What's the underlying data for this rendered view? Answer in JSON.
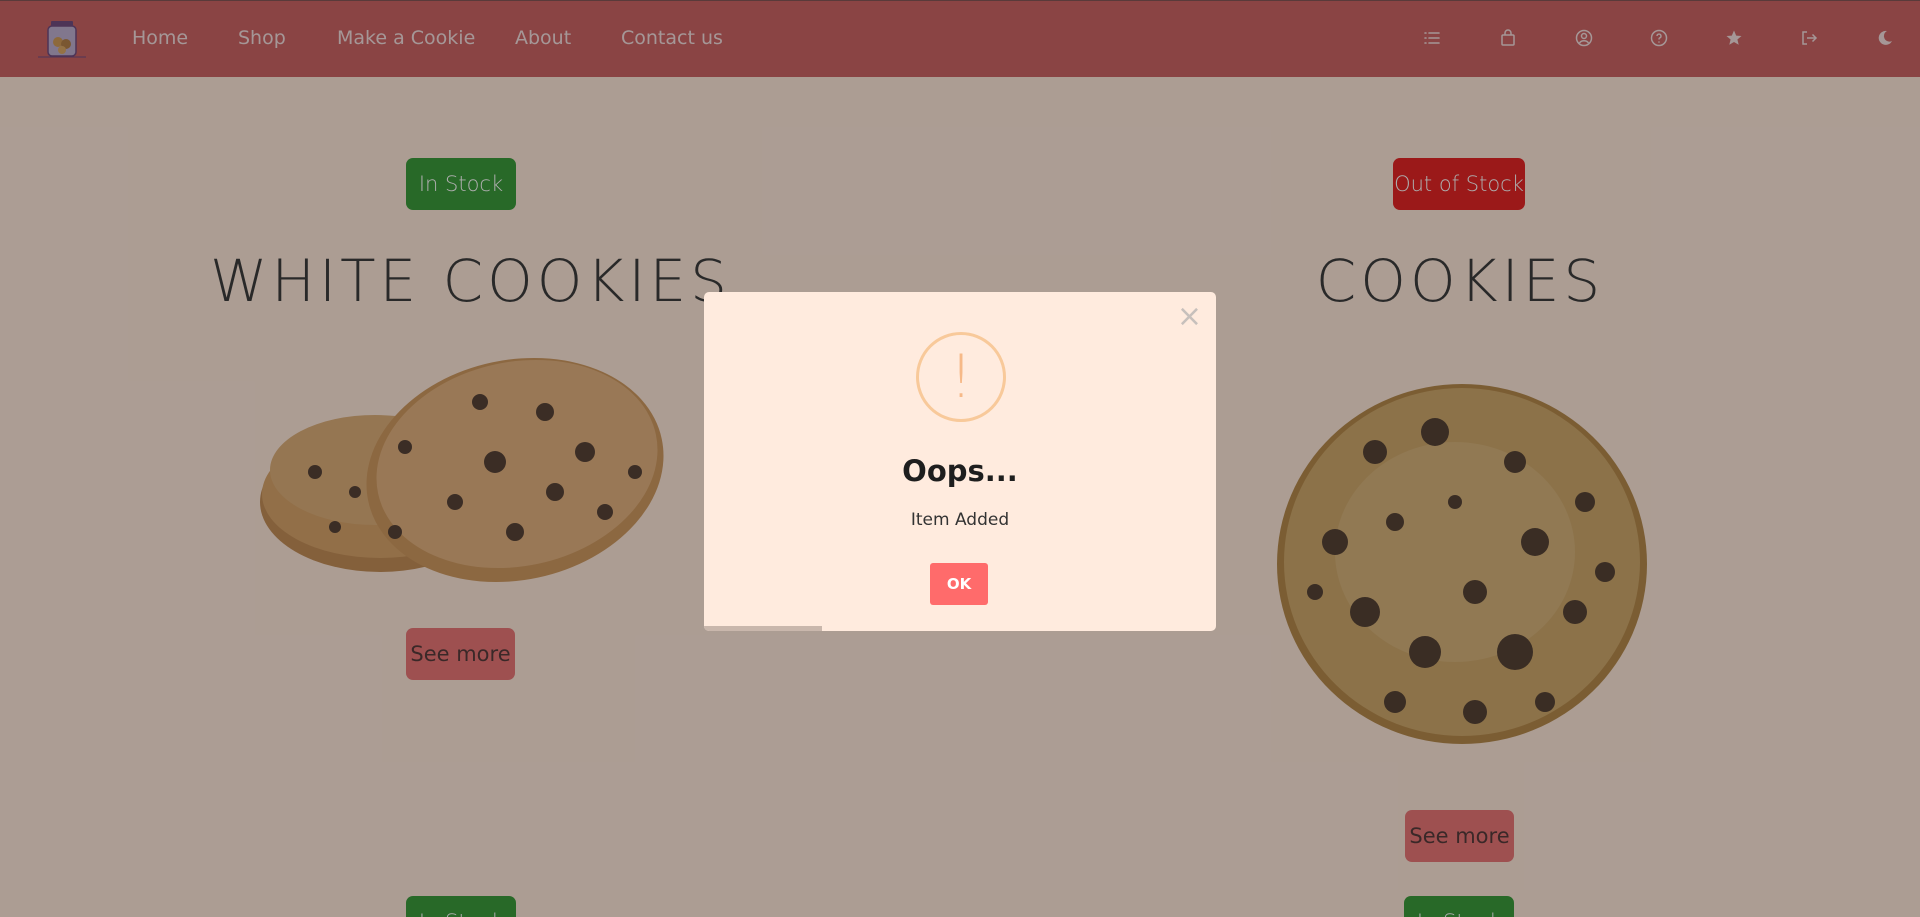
{
  "navbar": {
    "links": [
      "Home",
      "Shop",
      "Make a Cookie",
      "About",
      "Contact us"
    ],
    "icons": [
      "list-icon",
      "shopping-bag-icon",
      "user-circle-icon",
      "help-circle-icon",
      "star-icon",
      "logout-icon",
      "theme-toggle-icon"
    ]
  },
  "products": [
    {
      "status": "In Stock",
      "title": "WHITE COOKIES",
      "button": "See more"
    },
    {
      "status": "Out of Stock",
      "title": "COOKIES",
      "button": "See more"
    }
  ],
  "next_row": [
    {
      "status": "In Stock"
    },
    {
      "status": "In Stock"
    }
  ],
  "modal": {
    "icon": "!",
    "title": "Oops...",
    "text": "Item Added",
    "confirm": "OK",
    "close": "×",
    "timer_progress": 0.23
  },
  "colors": {
    "navbar": "#c34b4b",
    "in_stock": "#1b8a1b",
    "out_of_stock": "#e00000",
    "see_more": "#e56060",
    "confirm": "#ff6b6b",
    "modal_bg": "#ffebde"
  }
}
